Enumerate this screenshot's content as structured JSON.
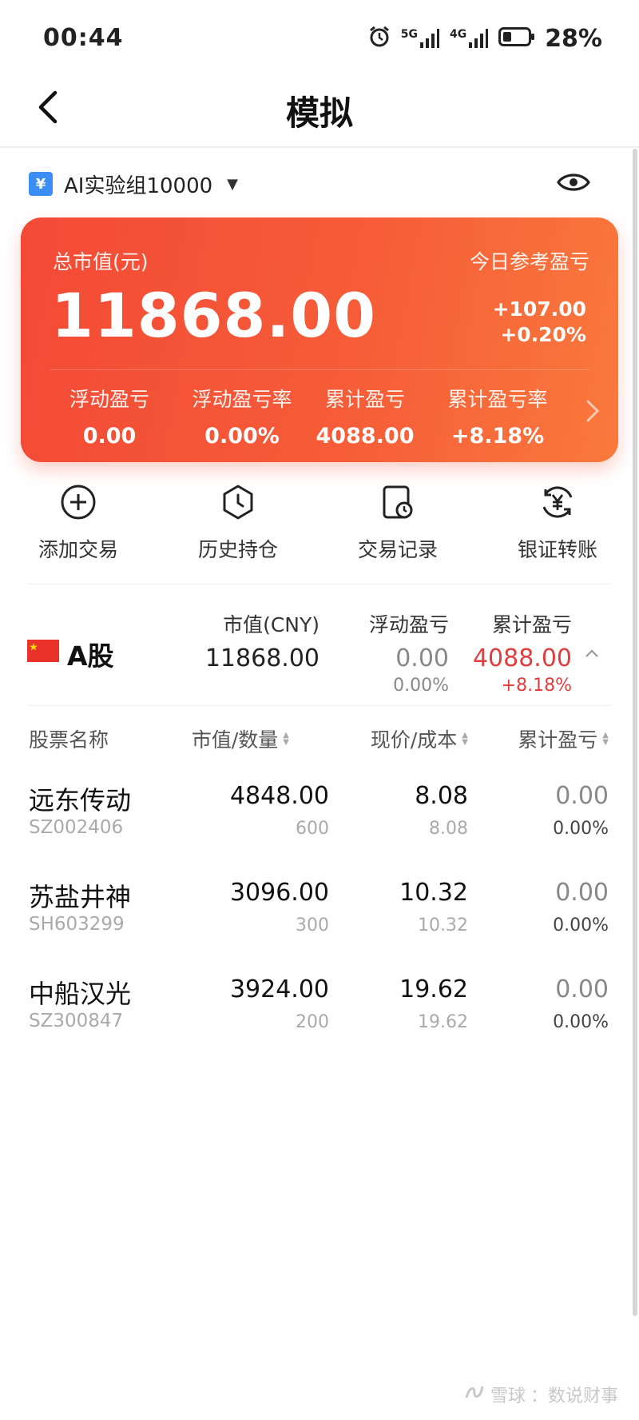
{
  "status_bar": {
    "time": "00:44",
    "network_5g": "5G",
    "network_4g": "4G",
    "battery": "28%"
  },
  "nav": {
    "title": "模拟",
    "back_icon": "chevron-left-icon"
  },
  "account": {
    "icon_glyph": "¥",
    "name": "AI实验组10000",
    "caret": "▼"
  },
  "summary": {
    "total_label": "总市值(元)",
    "total_value": "11868.00",
    "today_label": "今日参考盈亏",
    "today_amount": "+107.00",
    "today_pct": "+0.20%",
    "stats": [
      {
        "label": "浮动盈亏",
        "value": "0.00"
      },
      {
        "label": "浮动盈亏率",
        "value": "0.00%"
      },
      {
        "label": "累计盈亏",
        "value": "4088.00"
      },
      {
        "label": "累计盈亏率",
        "value": "+8.18%"
      }
    ]
  },
  "actions": [
    {
      "label": "添加交易",
      "icon": "add-circle-icon"
    },
    {
      "label": "历史持仓",
      "icon": "clock-hexagon-icon"
    },
    {
      "label": "交易记录",
      "icon": "record-clock-icon"
    },
    {
      "label": "银证转账",
      "icon": "yuan-transfer-icon"
    }
  ],
  "market": {
    "name": "A股",
    "market_value_label": "市值(CNY)",
    "market_value": "11868.00",
    "float_pnl_label": "浮动盈亏",
    "float_pnl": "0.00",
    "float_pnl_pct": "0.00%",
    "total_pnl_label": "累计盈亏",
    "total_pnl": "4088.00",
    "total_pnl_pct": "+8.18%",
    "accent_red": "#e23d3d"
  },
  "table": {
    "headers": {
      "name": "股票名称",
      "value_qty": "市值/数量",
      "price_cost": "现价/成本",
      "pnl": "累计盈亏"
    },
    "rows": [
      {
        "name": "远东传动",
        "code": "SZ002406",
        "value": "4848.00",
        "qty": "600",
        "price": "8.08",
        "cost": "8.08",
        "pnl": "0.00",
        "pnl_pct": "0.00%"
      },
      {
        "name": "苏盐井神",
        "code": "SH603299",
        "value": "3096.00",
        "qty": "300",
        "price": "10.32",
        "cost": "10.32",
        "pnl": "0.00",
        "pnl_pct": "0.00%"
      },
      {
        "name": "中船汉光",
        "code": "SZ300847",
        "value": "3924.00",
        "qty": "200",
        "price": "19.62",
        "cost": "19.62",
        "pnl": "0.00",
        "pnl_pct": "0.00%"
      }
    ]
  },
  "watermark": {
    "brand": "雪球",
    "author": "：数说财事"
  },
  "colors": {
    "card_start": "#f34a36",
    "card_end": "#f9793c",
    "account_icon": "#3a8ef6"
  }
}
